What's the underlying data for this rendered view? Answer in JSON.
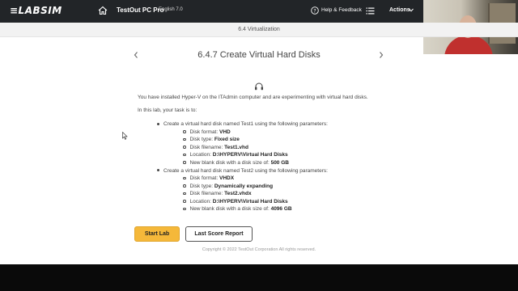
{
  "header": {
    "logo": "≡LABSIM",
    "app_title": "TestOut PC Pro",
    "language": "English 7.0",
    "help_label": "Help & Feedback",
    "actions_label": "Actions"
  },
  "section": "6.4 Virtualization",
  "lesson": {
    "title": "6.4.7 Create Virtual Hard Disks",
    "intro": "You have installed Hyper-V on the ITAdmin computer and are experimenting with virtual hard disks.",
    "task_intro": "In this lab, your task is to:",
    "tasks": [
      {
        "label": "Create a virtual hard disk named Test1 using the following parameters:",
        "params": [
          {
            "label": "Disk format: ",
            "value": "VHD"
          },
          {
            "label": "Disk type: ",
            "value": "Fixed size"
          },
          {
            "label": "Disk filename: ",
            "value": "Test1.vhd"
          },
          {
            "label": "Location: ",
            "value": "D:\\HYPERV\\Virtual Hard Disks"
          },
          {
            "label": "New blank disk with a disk size of: ",
            "value": "500 GB"
          }
        ]
      },
      {
        "label": "Create a virtual hard disk named Test2 using the following parameters:",
        "params": [
          {
            "label": "Disk format: ",
            "value": "VHDX"
          },
          {
            "label": "Disk type: ",
            "value": "Dynamically expanding"
          },
          {
            "label": "Disk filename: ",
            "value": "Test2.vhdx"
          },
          {
            "label": "Location: ",
            "value": "D:\\HYPERV\\Virtual Hard Disks"
          },
          {
            "label": "New blank disk with a disk size of: ",
            "value": "4096 GB"
          }
        ]
      }
    ]
  },
  "buttons": {
    "start_lab": "Start Lab",
    "last_score": "Last Score Report"
  },
  "footer": {
    "copyright": "Copyright © 2022 TestOut Corporation  All rights reserved."
  },
  "colors": {
    "topbar": "#222528",
    "start_button": "#f5b83a",
    "section_bar": "#f2f2f2"
  },
  "icons": [
    "home-icon",
    "help-icon",
    "list-icon",
    "chevron-down-icon",
    "chevron-left-icon",
    "chevron-right-icon",
    "headphones-icon"
  ]
}
